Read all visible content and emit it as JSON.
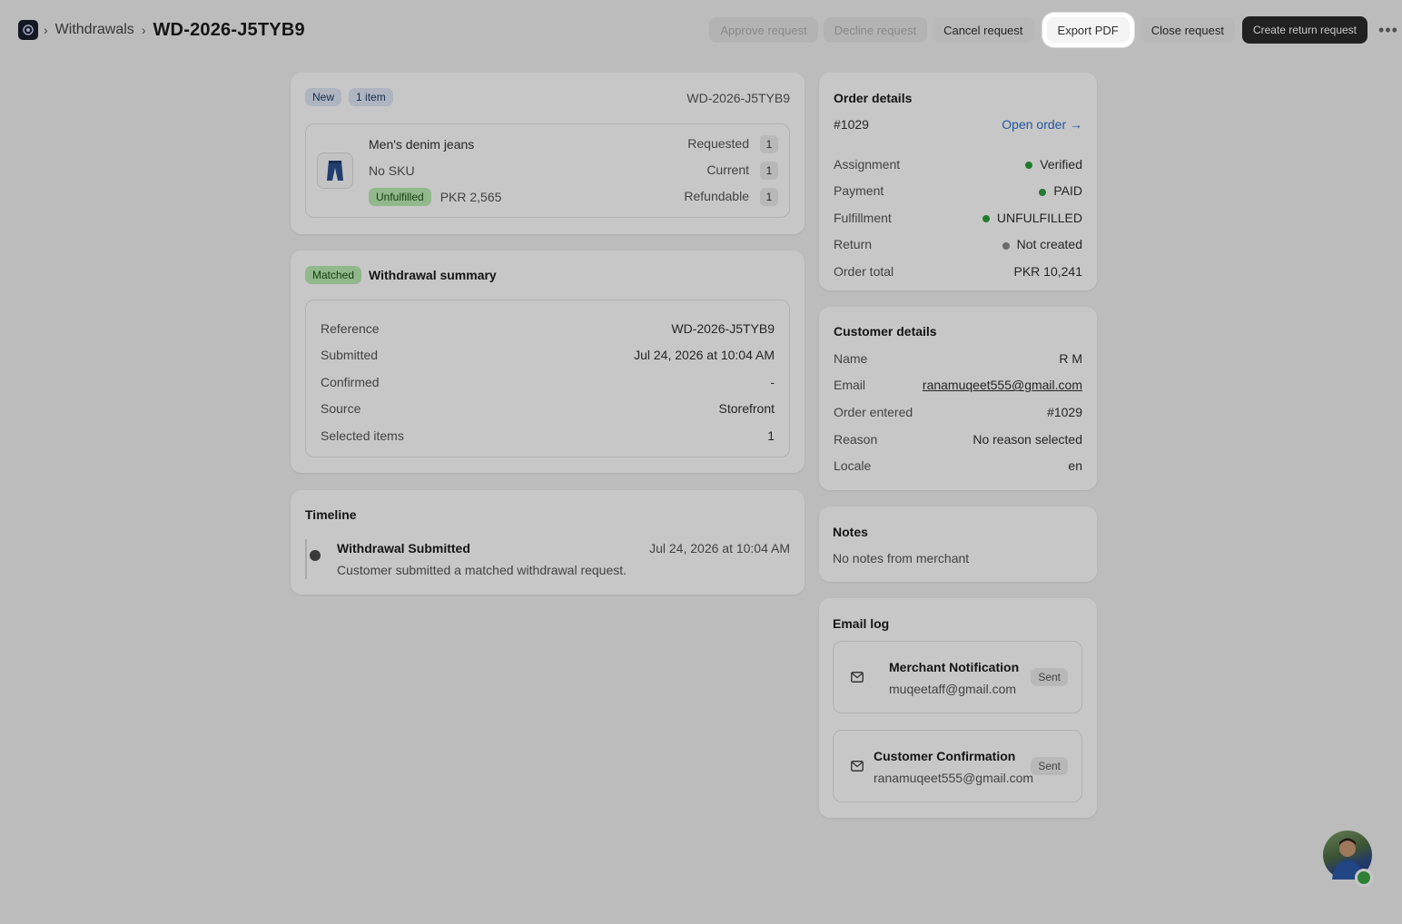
{
  "breadcrumb": {
    "parent": "Withdrawals",
    "current": "WD-2026-J5TYB9"
  },
  "toolbar": {
    "approve": "Approve request",
    "decline": "Decline request",
    "cancel": "Cancel request",
    "export": "Export PDF",
    "close": "Close request",
    "create_return": "Create return request",
    "more": "•••"
  },
  "item_card": {
    "status_badge": "New",
    "count_badge": "1 item",
    "reference": "WD-2026-J5TYB9",
    "product_name": "Men's denim jeans",
    "sku": "No SKU",
    "fulfillment_badge": "Unfulfilled",
    "price": "PKR 2,565",
    "quantities": [
      {
        "label": "Requested",
        "value": "1"
      },
      {
        "label": "Current",
        "value": "1"
      },
      {
        "label": "Refundable",
        "value": "1"
      }
    ]
  },
  "summary": {
    "badge": "Matched",
    "title": "Withdrawal summary",
    "rows": [
      {
        "label": "Reference",
        "value": "WD-2026-J5TYB9"
      },
      {
        "label": "Submitted",
        "value": "Jul 24, 2026 at 10:04 AM"
      },
      {
        "label": "Confirmed",
        "value": "-"
      },
      {
        "label": "Source",
        "value": "Storefront"
      },
      {
        "label": "Selected items",
        "value": "1"
      }
    ]
  },
  "timeline": {
    "title": "Timeline",
    "event_title": "Withdrawal Submitted",
    "event_desc": "Customer submitted a matched withdrawal request.",
    "event_time": "Jul 24, 2026 at 10:04 AM"
  },
  "order": {
    "title": "Order details",
    "number": "#1029",
    "open_link": "Open order →",
    "rows": [
      {
        "label": "Assignment",
        "value": "Verified",
        "dot": "green"
      },
      {
        "label": "Payment",
        "value": "PAID",
        "dot": "green"
      },
      {
        "label": "Fulfillment",
        "value": "UNFULFILLED",
        "dot": "green"
      },
      {
        "label": "Return",
        "value": "Not created",
        "dot": "gray"
      },
      {
        "label": "Order total",
        "value": "PKR 10,241",
        "dot": ""
      }
    ]
  },
  "customer": {
    "title": "Customer details",
    "name_label": "Name",
    "name": "R M",
    "email_label": "Email",
    "email": "ranamuqeet555@gmail.com",
    "order_label": "Order entered",
    "order": "#1029",
    "reason_label": "Reason",
    "reason": "No reason selected",
    "locale_label": "Locale",
    "locale": "en"
  },
  "notes": {
    "title": "Notes",
    "text": "No notes from merchant"
  },
  "email_log": {
    "title": "Email log",
    "entries": [
      {
        "title": "Merchant Notification",
        "email": "muqeetaff@gmail.com",
        "status": "Sent"
      },
      {
        "title": "Customer Confirmation",
        "email": "ranamuqeet555@gmail.com",
        "status": "Sent"
      }
    ]
  },
  "colors": {
    "accent": "#2c6ecb",
    "success": "#2e9e3a",
    "primary_button": "#2b2b2b"
  }
}
